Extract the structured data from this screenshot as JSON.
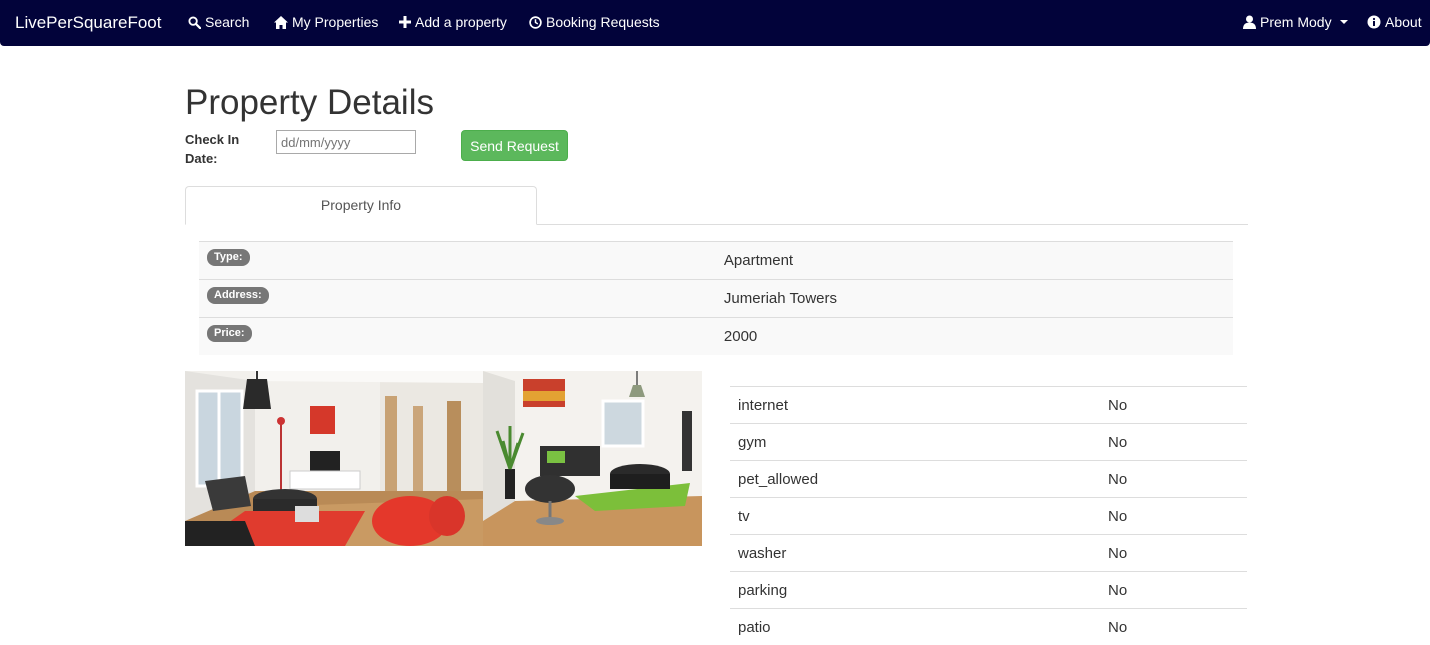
{
  "navbar": {
    "brand": "LivePerSquareFoot",
    "links": [
      {
        "label": "Search",
        "icon": "search-icon"
      },
      {
        "label": "My Properties",
        "icon": "home-icon"
      },
      {
        "label": "Add a property",
        "icon": "plus-icon"
      },
      {
        "label": "Booking Requests",
        "icon": "clock-icon"
      }
    ],
    "user": {
      "label": "Prem Mody",
      "icon": "user-icon"
    },
    "about": {
      "label": "About",
      "icon": "info-icon"
    }
  },
  "page": {
    "title": "Property Details",
    "checkin_label": "Check In Date:",
    "date_placeholder": "dd/mm/yyyy",
    "send_button": "Send Request"
  },
  "tabs": [
    {
      "label": "Property Info",
      "active": true
    }
  ],
  "info": [
    {
      "label": "Type:",
      "value": "Apartment"
    },
    {
      "label": "Address:",
      "value": "Jumeriah Towers"
    },
    {
      "label": "Price:",
      "value": "2000"
    }
  ],
  "amenities": [
    {
      "name": "internet",
      "value": "No"
    },
    {
      "name": "gym",
      "value": "No"
    },
    {
      "name": "pet_allowed",
      "value": "No"
    },
    {
      "name": "tv",
      "value": "No"
    },
    {
      "name": "washer",
      "value": "No"
    },
    {
      "name": "parking",
      "value": "No"
    },
    {
      "name": "patio",
      "value": "No"
    }
  ],
  "colors": {
    "navbar": "#02033a",
    "accent_button": "#5cb85c",
    "badge": "#777777"
  }
}
